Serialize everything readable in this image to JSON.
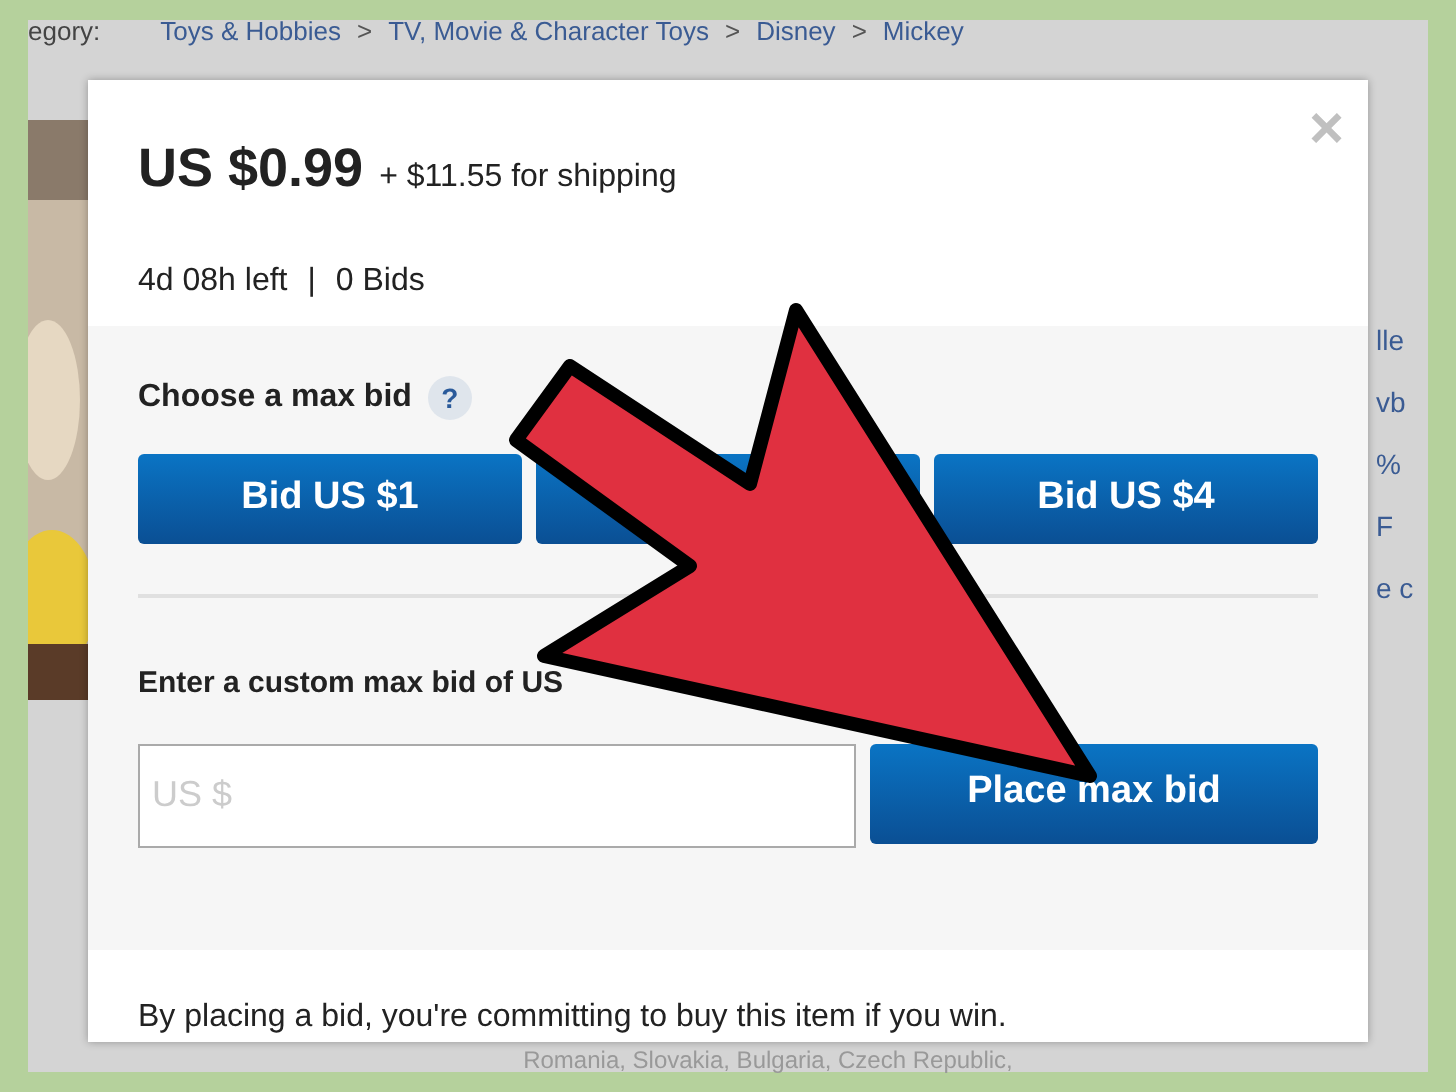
{
  "breadcrumb": {
    "label": "egory:",
    "items": [
      "Toys & Hobbies",
      "TV, Movie & Character Toys",
      "Disney",
      "Mickey"
    ],
    "separator": ">"
  },
  "side_fragments": [
    "lle",
    "vb",
    "%",
    "F",
    "e c"
  ],
  "footer_fragment": "Romania, Slovakia, Bulgaria, Czech Republic,",
  "dialog": {
    "close": "×",
    "price": "US $0.99",
    "shipping": "+ $11.55 for shipping",
    "time_left": "4d 08h left",
    "bids": "0 Bids",
    "divider": "|",
    "choose_label": "Choose a max bid",
    "help": "?",
    "bid_buttons": [
      {
        "label": "Bid US $1"
      },
      {
        "covered": true
      },
      {
        "label": "Bid US $4"
      }
    ],
    "custom_label": "Enter a custom max bid of US",
    "input": {
      "placeholder": "US $"
    },
    "submit": "Place max bid",
    "disclaimer": "By placing a bid, you're committing to buy this item if you win."
  }
}
